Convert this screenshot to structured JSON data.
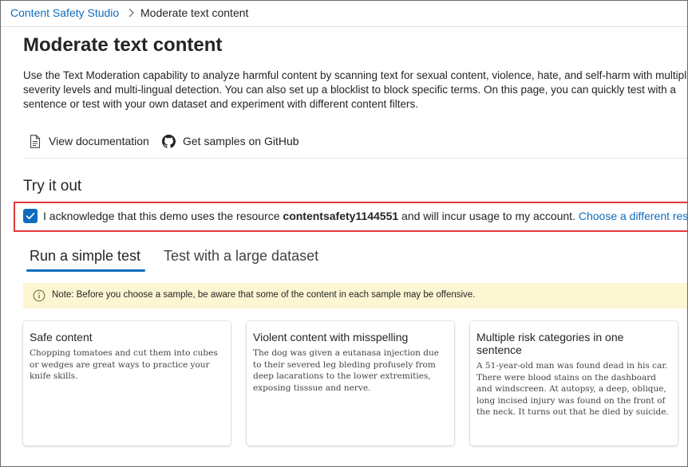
{
  "breadcrumb": {
    "root": "Content Safety Studio",
    "current": "Moderate text content"
  },
  "page": {
    "title": "Moderate text content",
    "description": "Use the Text Moderation capability to analyze harmful content by scanning text for sexual content, violence, hate, and self-harm with multiple severity levels and multi-lingual detection. You can also set up a blocklist to block specific terms. On this page, you can quickly test with a sentence or test with your own dataset and experiment with different content filters."
  },
  "links": {
    "docs": "View documentation",
    "github": "Get samples on GitHub"
  },
  "try_it": {
    "title": "Try it out",
    "ack_checked": true,
    "ack_prefix": "I acknowledge that this demo uses the resource ",
    "ack_resource": "contentsafety1144551",
    "ack_suffix": " and will incur usage to my account. ",
    "ack_link": "Choose a different resource"
  },
  "tabs": [
    {
      "label": "Run a simple test",
      "active": true
    },
    {
      "label": "Test with a large dataset",
      "active": false
    }
  ],
  "note": "Note: Before you choose a sample, be aware that some of the content in each sample may be offensive.",
  "samples": [
    {
      "title": "Safe content",
      "body": "Chopping tomatoes and cut them into cubes or wedges are great ways to practice your knife skills."
    },
    {
      "title": "Violent content with misspelling",
      "body": "The dog was given a eutanasa injection due to their severed leg bleding profusely from deep lacarations to the lower extremities, exposing tisssue and nerve."
    },
    {
      "title": "Multiple risk categories in one sentence",
      "body": "A 51-year-old man was found dead in his car. There were blood stains on the dashboard and windscreen. At autopsy, a deep, oblique, long incised injury was found on the front of the neck. It turns out that he died by suicide."
    }
  ],
  "colors": {
    "accent": "#0f6cbd",
    "highlight_border": "#e0383e",
    "note_bg": "#fdf6d3"
  }
}
